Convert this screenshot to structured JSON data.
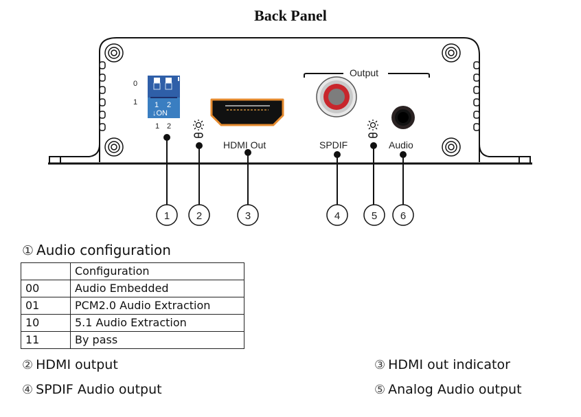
{
  "title": "Back Panel",
  "panel": {
    "dip_switch": {
      "row_labels": [
        "0",
        "1"
      ],
      "top_numbers": [
        "1",
        "2"
      ],
      "on_label": "↓ON",
      "bottom_numbers": [
        "1",
        "2"
      ],
      "color": "#3a7ec1"
    },
    "hdmi_label": "HDMI Out",
    "output_group_label": "Output",
    "spdif_label": "SPDIF",
    "audio_label": "Audio",
    "indicator_icons": [
      "led-sun-icon",
      "led-sun-icon"
    ],
    "spdif_ring_color": "#c8262c",
    "hdmi_trim_color": "#e58a2e"
  },
  "callouts": [
    "1",
    "2",
    "3",
    "4",
    "5",
    "6"
  ],
  "audio_config": {
    "number": "①",
    "heading": "Audio configuration",
    "table": {
      "header": [
        "",
        "Configuration"
      ],
      "rows": [
        [
          "00",
          "Audio Embedded"
        ],
        [
          "01",
          "PCM2.0 Audio Extraction"
        ],
        [
          "10",
          "5.1 Audio Extraction"
        ],
        [
          "11",
          "By pass"
        ]
      ]
    }
  },
  "legend": [
    {
      "number": "②",
      "label": "HDMI output"
    },
    {
      "number": "③",
      "label": "HDMI out indicator"
    },
    {
      "number": "④",
      "label": "SPDIF Audio output"
    },
    {
      "number": "⑤",
      "label": "Analog Audio output"
    }
  ]
}
